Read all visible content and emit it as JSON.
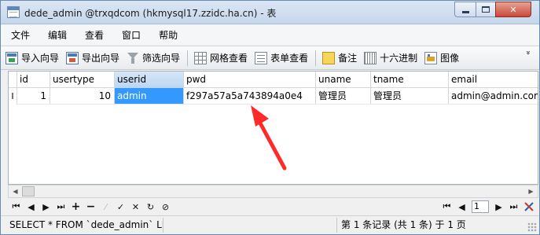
{
  "window": {
    "title": "dede_admin @trxqdcom (hkmysql17.zzidc.ha.cn) - 表",
    "min_label": "",
    "max_label": "",
    "close_label": "✕"
  },
  "menu": [
    "文件",
    "编辑",
    "查看",
    "窗口",
    "帮助"
  ],
  "toolbar": {
    "import": "导入向导",
    "export": "导出向导",
    "filter": "筛选向导",
    "grid_view": "网格查看",
    "form_view": "表单查看",
    "memo": "备注",
    "hex": "十六进制",
    "image": "图像",
    "more": "»"
  },
  "table": {
    "columns": [
      "id",
      "usertype",
      "userid",
      "pwd",
      "uname",
      "tname",
      "email"
    ],
    "row_marker": "I",
    "rows": [
      [
        "1",
        "10",
        "admin",
        "f297a57a5a743894a0e4",
        "管理员",
        "管理员",
        "admin@admin.com"
      ]
    ],
    "selected_column": "userid"
  },
  "nav": {
    "first": "⏮",
    "prev": "◀",
    "next": "▶",
    "last": "⏭",
    "add": "+",
    "delete": "−",
    "edit": "⁄",
    "apply": "✓",
    "cancel": "✕",
    "refresh": "↻",
    "stop": "⊘",
    "page_value": "1",
    "page_first": "⏮",
    "page_prev": "◀",
    "page_next": "▶",
    "page_last": "⏭"
  },
  "status": {
    "sql": "SELECT * FROM `dede_admin` LIM",
    "info": "第 1 条记录 (共 1 条) 于 1 页"
  },
  "colors": {
    "selection": "#3399ff",
    "arrow": "#ff2a2a"
  }
}
